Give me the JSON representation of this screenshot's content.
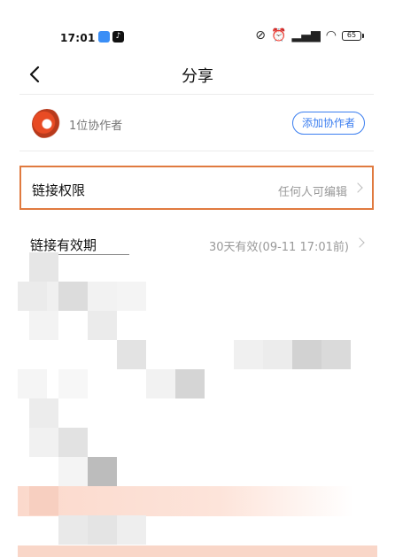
{
  "status_bar": {
    "time": "17:01",
    "icons": [
      "app-blue-icon",
      "tiktok-icon"
    ],
    "right_icons": "⚡ ⏰ ᵢₗ ≋",
    "battery": "65"
  },
  "nav": {
    "title": "分享",
    "back_icon": "back-arrow-icon"
  },
  "collaborators": {
    "count_label": "1位协作者",
    "add_button": "添加协作者"
  },
  "settings": {
    "link_permission": {
      "label": "链接权限",
      "value": "任何人可编辑"
    },
    "link_validity": {
      "label": "链接有效期",
      "value": "30天有效(09-11 17:01前)"
    }
  },
  "colors": {
    "accent": "#3b7ef0",
    "highlight_border": "#e07a3f"
  }
}
